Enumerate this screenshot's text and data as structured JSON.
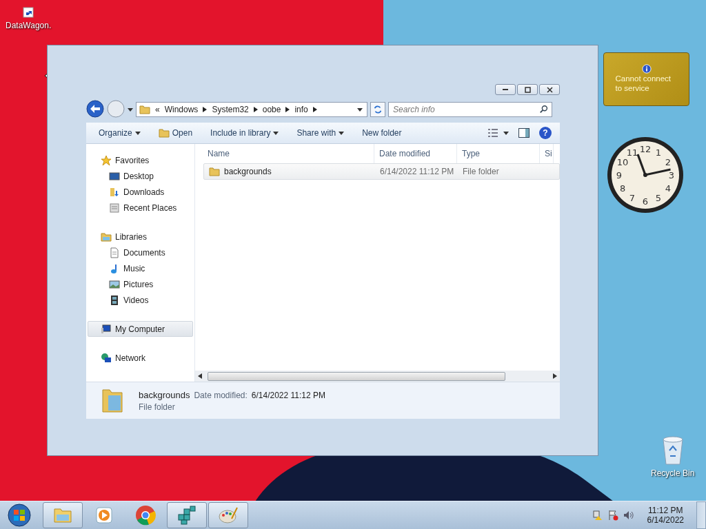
{
  "desktop": {
    "icons": [
      {
        "label": "DataWagon.",
        "kind": "shortcut"
      },
      {
        "label": "Recycle Bin",
        "kind": "recycle"
      }
    ]
  },
  "gadgets": {
    "weather": {
      "message": "Cannot connect to service"
    },
    "clock": {
      "numerals": [
        "12",
        "11",
        "1",
        "10",
        "2",
        "9",
        "3",
        "8",
        "4",
        "7",
        "5",
        "6"
      ]
    }
  },
  "explorer": {
    "breadcrumb_overflow": "«",
    "breadcrumb": [
      "Windows",
      "System32",
      "oobe",
      "info"
    ],
    "search": {
      "placeholder": "Search info"
    },
    "help_label": "?",
    "toolbar": [
      {
        "label": "Organize",
        "kind": "menu"
      },
      {
        "label": "Open",
        "kind": "open"
      },
      {
        "label": "Include in library",
        "kind": "menu"
      },
      {
        "label": "Share with",
        "kind": "menu"
      },
      {
        "label": "New folder",
        "kind": "plain"
      }
    ],
    "sidebar": [
      {
        "label": "Favorites",
        "kind": "star",
        "selected": false,
        "children": [
          {
            "label": "Desktop",
            "kind": "desktop",
            "selected": false
          },
          {
            "label": "Downloads",
            "kind": "downloads",
            "selected": false
          },
          {
            "label": "Recent Places",
            "kind": "recent",
            "selected": false
          }
        ]
      },
      {
        "label": "Libraries",
        "kind": "library",
        "selected": false,
        "children": [
          {
            "label": "Documents",
            "kind": "document",
            "selected": false
          },
          {
            "label": "Music",
            "kind": "music",
            "selected": false
          },
          {
            "label": "Pictures",
            "kind": "picture",
            "selected": false
          },
          {
            "label": "Videos",
            "kind": "video",
            "selected": false
          }
        ]
      },
      {
        "label": "My Computer",
        "kind": "computer",
        "selected": true
      },
      {
        "label": "Network",
        "kind": "network",
        "selected": false
      }
    ],
    "columns": [
      "Name",
      "Date modified",
      "Type",
      "Si"
    ],
    "rows": [
      {
        "name": "backgrounds",
        "date": "6/14/2022 11:12 PM",
        "type": "File folder",
        "selected": true
      }
    ],
    "details": {
      "name": "backgrounds",
      "date_label": "Date modified:",
      "date": "6/14/2022 11:12 PM",
      "type": "File folder"
    }
  },
  "taskbar": {
    "items": [
      {
        "kind": "explorer",
        "running": true
      },
      {
        "kind": "media",
        "running": false
      },
      {
        "kind": "chrome",
        "running": false
      },
      {
        "kind": "registry",
        "running": true
      },
      {
        "kind": "paint",
        "running": true
      }
    ],
    "time": "11:12 PM",
    "date": "6/14/2022"
  }
}
